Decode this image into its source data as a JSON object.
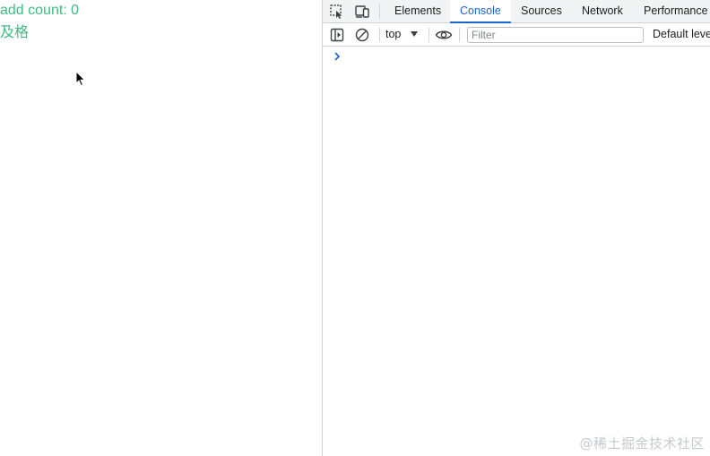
{
  "app": {
    "lines": [
      "add count: 0",
      "及格"
    ],
    "text_color": "#42b983"
  },
  "devtools": {
    "tabs": [
      "Elements",
      "Console",
      "Sources",
      "Network",
      "Performance"
    ],
    "active_tab": "Console",
    "accent_color": "#1a64d4",
    "toolbar": {
      "context": "top",
      "filter_placeholder": "Filter",
      "filter_value": "",
      "levels_label": "Default levels"
    },
    "icons": {
      "inspect": "inspect-element-icon",
      "device": "device-toolbar-icon",
      "sidebar": "console-sidebar-icon",
      "clear": "clear-console-icon",
      "eye": "live-expression-eye-icon",
      "prompt": "chevron-right-icon"
    }
  },
  "watermark": "@稀土掘金技术社区"
}
